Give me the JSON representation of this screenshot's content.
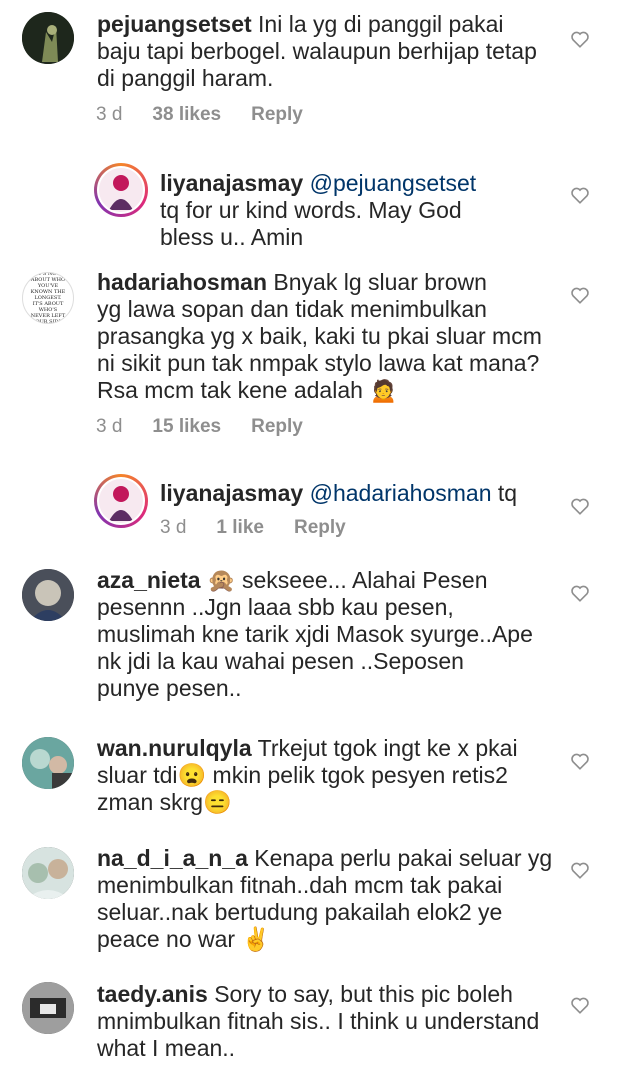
{
  "comments": [
    {
      "username": "pejuangsetset",
      "lines": [
        "Ini la yg di panggil pakai",
        "baju tapi berbogel. walaupun berhijap tetap",
        "di panggil haram."
      ],
      "time": "3 d",
      "likes": "38 likes",
      "reply": "Reply"
    },
    {
      "username": "liyanajasmay",
      "mention": "@pejuangsetset",
      "lines": [
        "tq for ur kind words. May God",
        "bless u.. Amin"
      ]
    },
    {
      "username": "hadariahosman",
      "avatar_text": "IT'S NOT ABOUT WHO YOU'VE KNOWN THE LONGEST. IT'S ABOUT WHO'S NEVER LEFT YOUR SIDE.",
      "lines": [
        "Bnyak lg sluar brown",
        "yg lawa sopan dan tidak menimbulkan",
        "prasangka yg x baik, kaki tu pkai sluar mcm",
        "ni sikit pun tak nmpak stylo lawa kat mana?",
        "Rsa mcm tak kene adalah 🙍"
      ],
      "time": "3 d",
      "likes": "15 likes",
      "reply": "Reply"
    },
    {
      "username": "liyanajasmay",
      "mention": "@hadariahosman",
      "suffix": "tq",
      "time": "3 d",
      "likes": "1 like",
      "reply": "Reply"
    },
    {
      "username": "aza_nieta",
      "lines": [
        "🙊 sekseee... Alahai Pesen",
        "pesennn ..Jgn laaa sbb kau pesen,",
        "muslimah kne tarik xjdi Masok syurge..Ape",
        "nk jdi la kau wahai pesen ..Seposen",
        "punye pesen.."
      ]
    },
    {
      "username": "wan.nurulqyla",
      "lines": [
        "Trkejut tgok ingt ke x pkai",
        "sluar tdi😦 mkin pelik tgok pesyen retis2",
        "zman skrg😑"
      ]
    },
    {
      "username": "na_d_i_a_n_a",
      "lines": [
        "Kenapa perlu pakai seluar yg",
        "menimbulkan fitnah..dah mcm tak pakai",
        "seluar..nak bertudung pakailah elok2 ye",
        "peace no war ✌"
      ]
    },
    {
      "username": "taedy.anis",
      "lines": [
        "Sory to say, but this pic boleh",
        "mnimbulkan fitnah sis.. I think u understand",
        "what I mean.."
      ]
    }
  ],
  "icons": {
    "like": "heart-outline-icon"
  }
}
